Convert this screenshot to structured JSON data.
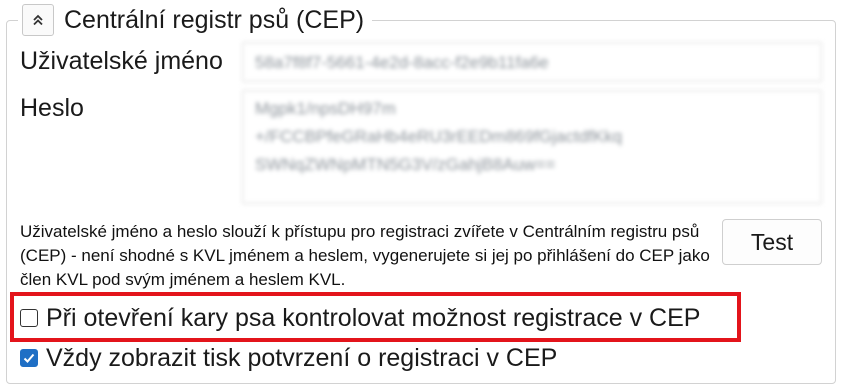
{
  "group": {
    "title": "Centrální registr psů (CEP)",
    "collapse_icon": "double-chevron-up-icon"
  },
  "username": {
    "label": "Uživatelské jméno",
    "value": "58a7f8f7-5661-4e2d-8acc-f2e9b11fa6e"
  },
  "password": {
    "label": "Heslo",
    "value": "Mgpk1/npsDH97m\n+/FCCBPfeGRaHb4eRU3rEEDm869fGjactdfKkq\nSWNqZWNpMTN5G3V/zGahjB8Auw=="
  },
  "note": "Uživatelské jméno a heslo slouží k přístupu pro registraci zvířete v Centrálním registru psů (CEP) - není shodné s KVL jménem a heslem, vygenerujete si jej po přihlášení do CEP jako člen KVL pod svým jménem a heslem KVL.",
  "test_button": "Test",
  "checkboxes": [
    {
      "label": "Při otevření kary psa kontrolovat možnost registrace v CEP",
      "checked": false
    },
    {
      "label": "Vždy zobrazit tisk potvrzení o registraci v CEP",
      "checked": true
    }
  ],
  "colors": {
    "highlight": "#e3141b",
    "checkbox_checked": "#1f6fc5"
  }
}
